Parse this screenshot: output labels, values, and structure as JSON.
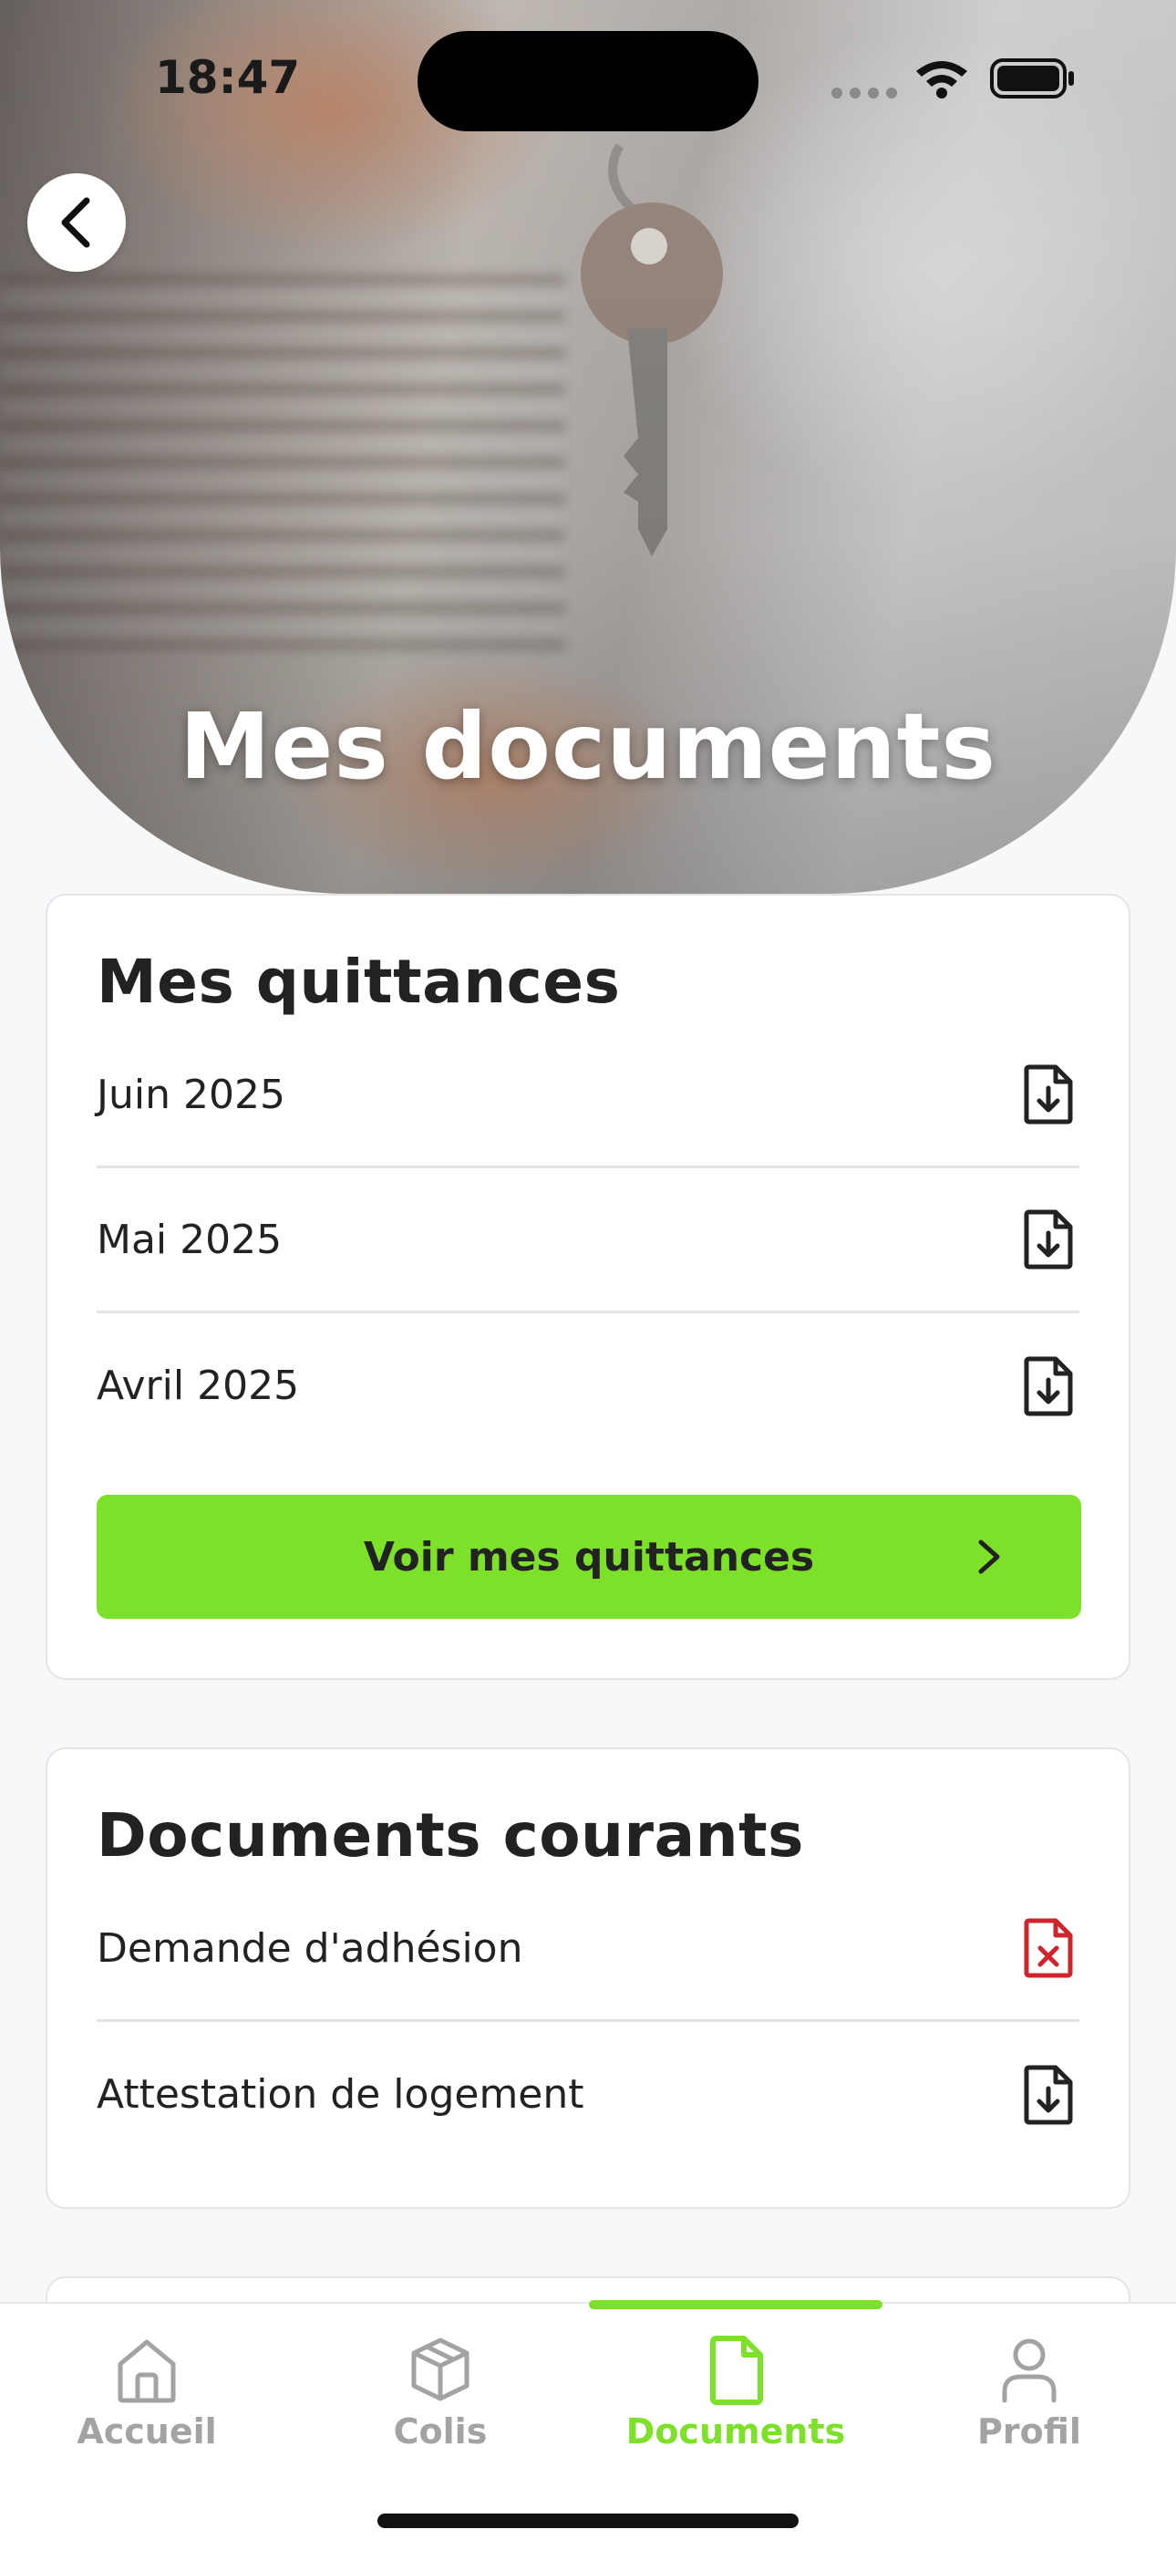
{
  "status_bar": {
    "time": "18:47"
  },
  "header": {
    "title": "Mes documents",
    "back_icon": "chevron-left-icon"
  },
  "quittances": {
    "title": "Mes quittances",
    "items": [
      {
        "label": "Juin 2025",
        "icon": "file-download-icon"
      },
      {
        "label": "Mai 2025",
        "icon": "file-download-icon"
      },
      {
        "label": "Avril 2025",
        "icon": "file-download-icon"
      }
    ],
    "button_label": "Voir mes quittances"
  },
  "documents_courants": {
    "title": "Documents courants",
    "items": [
      {
        "label": "Demande d'adhésion",
        "icon": "file-error-icon"
      },
      {
        "label": "Attestation de logement",
        "icon": "file-download-icon"
      }
    ]
  },
  "tabbar": {
    "active": "Documents",
    "tabs": [
      {
        "label": "Accueil",
        "icon": "home-icon"
      },
      {
        "label": "Colis",
        "icon": "package-icon"
      },
      {
        "label": "Documents",
        "icon": "document-icon"
      },
      {
        "label": "Profil",
        "icon": "user-icon"
      }
    ]
  },
  "colors": {
    "accent": "#7de12a",
    "error": "#d0242c",
    "text": "#222222",
    "inactive": "#a3a3a3"
  }
}
